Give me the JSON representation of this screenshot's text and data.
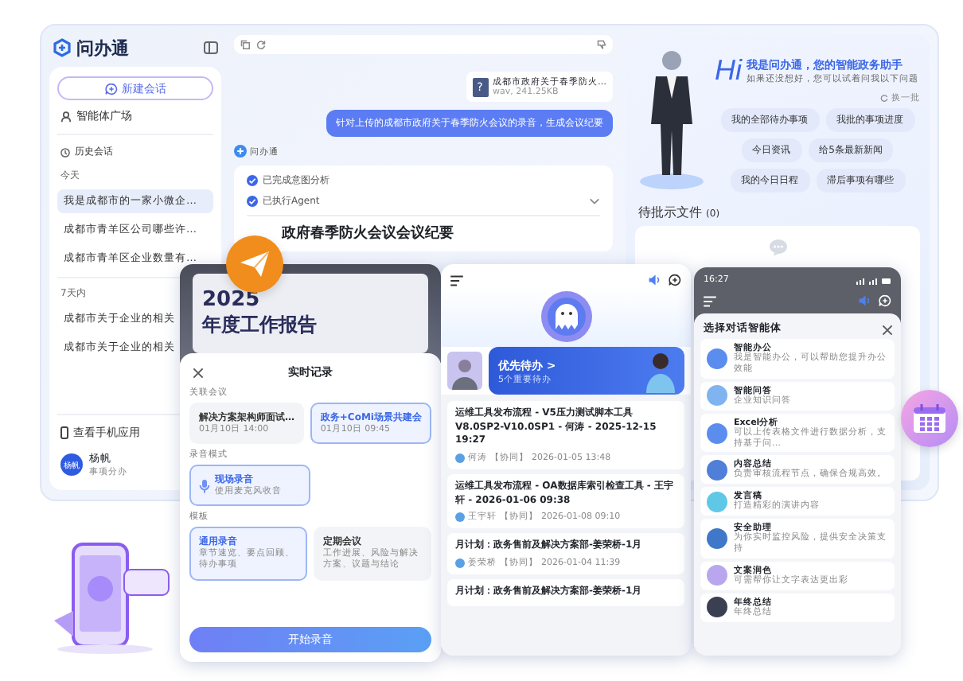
{
  "sidebar": {
    "logo": "问办通",
    "new_chat": "新建会话",
    "agent_square": "智能体广场",
    "history_title": "历史会话",
    "groups": [
      {
        "label": "今天",
        "items": [
          {
            "text": "我是成都市的一家小微企…",
            "selected": true
          },
          {
            "text": "成都市青羊区公司哪些许…",
            "selected": false
          },
          {
            "text": "成都市青羊区企业数量有…",
            "selected": false
          }
        ]
      },
      {
        "label": "7天内",
        "items": [
          {
            "text": "成都市关于企业的相关",
            "selected": false
          },
          {
            "text": "成都市关于企业的相关",
            "selected": false
          }
        ]
      }
    ],
    "mobile_app": "查看手机应用",
    "user": {
      "avatar": "杨帆",
      "name": "杨帆",
      "role": "事项分办"
    }
  },
  "chat": {
    "file": {
      "icon": "?",
      "name": "成都市政府关于春季防火…",
      "meta": "wav, 241.25KB"
    },
    "message": "针对上传的成都市政府关于春季防火会议的录音，生成会议纪要",
    "bot_name": "问办通",
    "steps": [
      {
        "text": "已完成意图分析",
        "done": true
      },
      {
        "text": "已执行Agent",
        "done": true
      }
    ],
    "doc_title": "政府春季防火会议会议纪要"
  },
  "assistant": {
    "hi": "Hi",
    "title": "我是问办通，您的智能政务助手",
    "subtitle": "如果还没想好，您可以试着问我以下问题",
    "refresh": "换一批",
    "suggestions": [
      "我的全部待办事项",
      "我批的事项进度",
      "今日资讯",
      "给5条最新新闻",
      "我的今日日程",
      "滞后事项有哪些"
    ],
    "pending_title": "待批示文件",
    "pending_count": "(0)"
  },
  "meeting_phone": {
    "cover_year": "2025",
    "cover_title": "年度工作报告",
    "title": "实时记录",
    "related_label": "关联会议",
    "meetings": [
      {
        "title": "解决方案架构师面试…",
        "time": "01月10日 14:00",
        "selected": false
      },
      {
        "title": "政务+CoMi场景共建会",
        "time": "01月10日 09:45",
        "selected": true
      }
    ],
    "mode_label": "录音模式",
    "modes": [
      {
        "title": "现场录音",
        "sub": "使用麦克风收音",
        "selected": true
      }
    ],
    "template_label": "模板",
    "templates": [
      {
        "title": "通用录音",
        "sub": "章节速览、要点回顾、待办事项",
        "selected": true
      },
      {
        "title": "定期会议",
        "sub": "工作进展、风险与解决方案、议题与结论",
        "selected": false
      }
    ],
    "start": "开始录音"
  },
  "todo_phone": {
    "banner_title": "优先待办 >",
    "banner_sub": "5个重要待办",
    "items": [
      {
        "title": "运维工具发布流程 - V5压力测试脚本工具V8.0SP2-V10.0SP1 - 何涛 - 2025-12-15 19:27",
        "author": "何涛",
        "tag": "【协同】",
        "time": "2026-01-05 13:48"
      },
      {
        "title": "运维工具发布流程 - OA数据库索引检查工具 - 王宇轩 - 2026-01-06 09:38",
        "author": "王宇轩",
        "tag": "【协同】",
        "time": "2026-01-08 09:10"
      },
      {
        "title": "月计划：政务售前及解决方案部-姜荣桥-1月",
        "author": "姜荣桥",
        "tag": "【协同】",
        "time": "2026-01-04 11:39"
      },
      {
        "title": "月计划：政务售前及解决方案部-姜荣桥-1月"
      }
    ]
  },
  "agent_phone": {
    "time": "16:27",
    "title": "选择对话智能体",
    "agents": [
      {
        "name": "智能办公",
        "desc": "我是智能办公，可以帮助您提升办公效能",
        "color": "#5b8def"
      },
      {
        "name": "智能问答",
        "desc": "企业知识问答",
        "color": "#7fb4f0"
      },
      {
        "name": "Excel分析",
        "desc": "可以上传表格文件进行数据分析，支持基于问…",
        "color": "#5b8def"
      },
      {
        "name": "内容总结",
        "desc": "负责审核流程节点，确保合规高效。",
        "color": "#4f7fd8"
      },
      {
        "name": "发言稿",
        "desc": "打造精彩的演讲内容",
        "color": "#5ec8e6"
      },
      {
        "name": "安全助理",
        "desc": "为你实时监控风险，提供安全决策支持",
        "color": "#3f78c9"
      },
      {
        "name": "文案润色",
        "desc": "可需帮你让文字表达更出彩",
        "color": "#b9a6ee"
      },
      {
        "name": "年终总结",
        "desc": "年终总结",
        "color": "#3a3f52"
      }
    ]
  }
}
